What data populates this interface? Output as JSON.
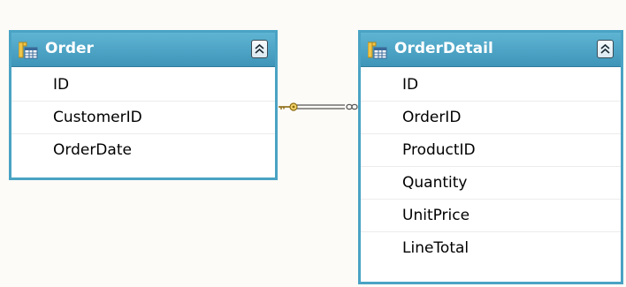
{
  "diagram": {
    "tables": [
      {
        "name": "Order",
        "columns": [
          "ID",
          "CustomerID",
          "OrderDate"
        ]
      },
      {
        "name": "OrderDetail",
        "columns": [
          "ID",
          "OrderID",
          "ProductID",
          "Quantity",
          "UnitPrice",
          "LineTotal"
        ]
      }
    ],
    "relationship": {
      "from_table": "Order",
      "to_table": "OrderDetail",
      "one_end_icon": "key-icon",
      "many_end_icon": "infinity-icon"
    }
  },
  "colors": {
    "header": "#4aa3c4",
    "border": "#4aa3c4",
    "connector": "#c2a33a",
    "background": "#fdfbf7"
  }
}
